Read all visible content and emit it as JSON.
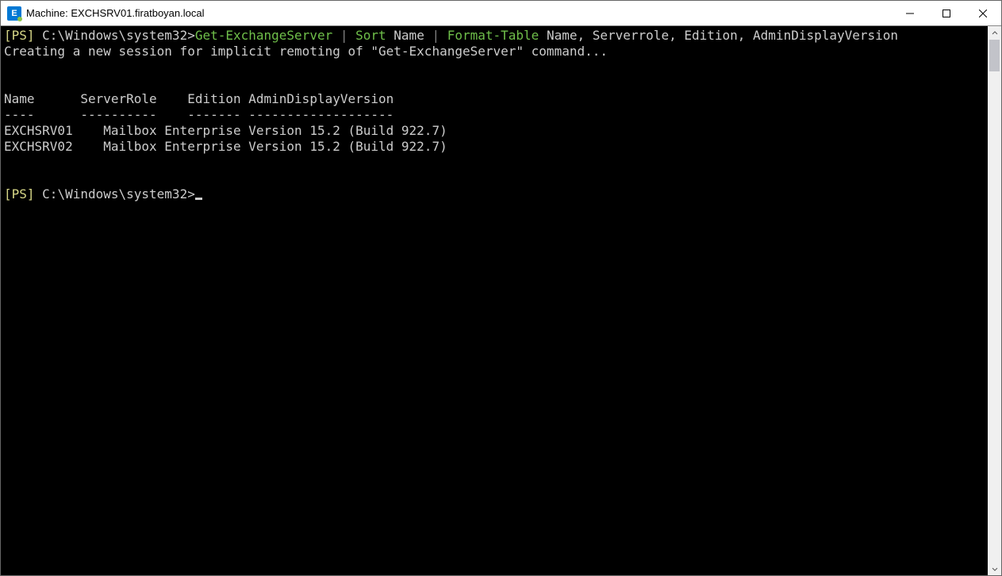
{
  "window": {
    "icon_letter": "E",
    "title": "Machine: EXCHSRV01.firatboyan.local"
  },
  "prompt": {
    "ps_tag": "[PS]",
    "path": "C:\\Windows\\system32>"
  },
  "command": {
    "cmdlet1": "Get-ExchangeServer",
    "pipe1": " | ",
    "cmdlet2": "Sort",
    "arg2": " Name ",
    "pipe2": "| ",
    "cmdlet3": "Format-Table",
    "arg3": " Name, Serverrole, Edition, AdminDisplayVersion"
  },
  "status_line": "Creating a new session for implicit remoting of \"Get-ExchangeServer\" command...",
  "table": {
    "headers_line": "Name      ServerRole    Edition AdminDisplayVersion",
    "divider_line": "----      ----------    ------- -------------------",
    "rows": [
      "EXCHSRV01    Mailbox Enterprise Version 15.2 (Build 922.7)",
      "EXCHSRV02    Mailbox Enterprise Version 15.2 (Build 922.7)"
    ]
  },
  "prompt2": {
    "ps_tag": "[PS]",
    "path": "C:\\Windows\\system32>"
  }
}
